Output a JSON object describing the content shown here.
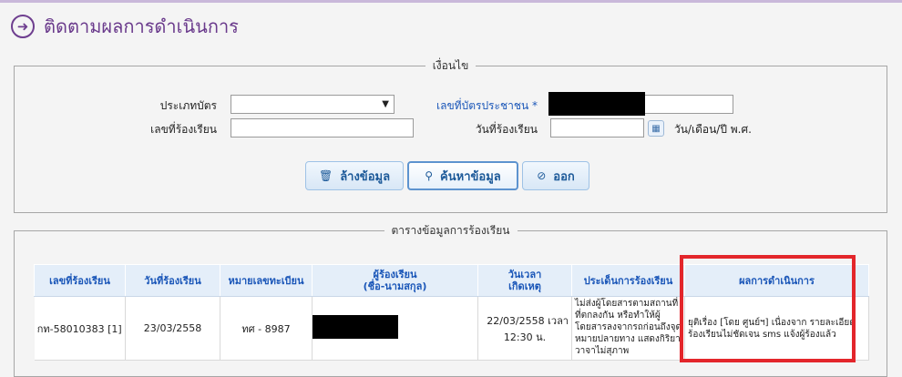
{
  "header": {
    "title": "ติดตามผลการดำเนินการ",
    "icon": "arrow-right-circle-icon"
  },
  "conditions": {
    "legend": "เงื่อนไข",
    "card_type_label": "ประเภทบัตร",
    "card_type_value": "",
    "id_number_label": "เลขที่บัตรประชาชน *",
    "complaint_no_label": "เลขที่ร้องเรียน",
    "complaint_no_value": "",
    "complaint_date_label": "วันที่ร้องเรียน",
    "complaint_date_value": "",
    "date_format_hint": "วัน/เดือน/ปี พ.ศ."
  },
  "buttons": {
    "clear": "ล้างข้อมูล",
    "search": "ค้นหาข้อมูล",
    "exit": "ออก"
  },
  "grid": {
    "legend": "ตารางข้อมูลการร้องเรียน",
    "columns": {
      "complaint_no": "เลขที่ร้องเรียน",
      "complaint_date": "วันที่ร้องเรียน",
      "plate_no": "หมายเลขทะเบียน",
      "complainant_l1": "ผู้ร้องเรียน",
      "complainant_l2": "(ชื่อ-นามสกุล)",
      "datetime_l1": "วันเวลา",
      "datetime_l2": "เกิดเหตุ",
      "issue": "ประเด็นการร้องเรียน",
      "result": "ผลการดำเนินการ"
    },
    "rows": [
      {
        "complaint_no": "กท-58010383 [1]",
        "complaint_date": "23/03/2558",
        "plate_no": "ทศ - 8987",
        "datetime_l1": "22/03/2558 เวลา",
        "datetime_l2": "12:30 น.",
        "issue": "ไม่ส่งผู้โดยสารตามสถานที่ที่ตกลงกัน หรือทำให้ผู้โดยสารลงจากรถก่อนถึงจุดหมายปลายทาง แสดงกิริยาวาจาไม่สุภาพ",
        "result": "ยุติเรื่อง [โดย ศูนย์ฯ] เนื่องจาก รายละเอียดร้องเรียนไม่ชัดเจน sms แจ้งผู้ร้องแล้ว"
      }
    ]
  },
  "colors": {
    "title": "#6a3a8c",
    "header_text": "#1a56b8",
    "highlight": "#e3262b"
  }
}
